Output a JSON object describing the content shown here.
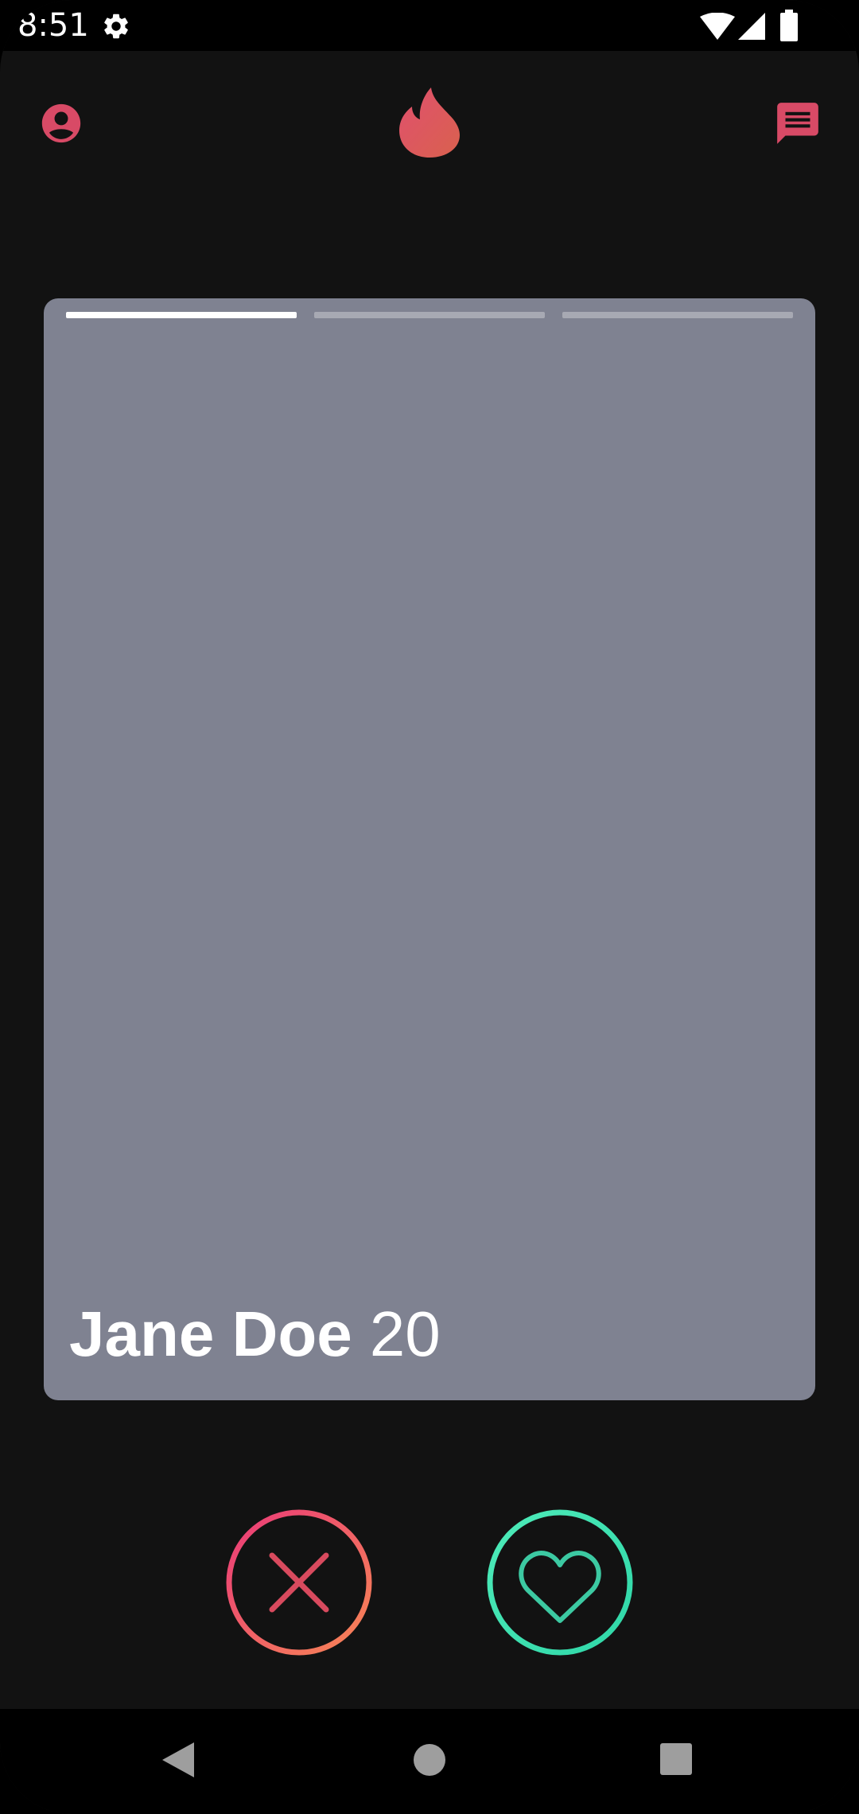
{
  "status_bar": {
    "time": "8:51",
    "icons": [
      "settings-gear-icon",
      "wifi-icon",
      "cellular-signal-icon",
      "battery-icon"
    ]
  },
  "header": {
    "left_icon": "profile-icon",
    "center_icon": "flame-logo-icon",
    "right_icon": "messages-icon"
  },
  "card": {
    "photo_count": 3,
    "active_photo": 1,
    "name": "Jane Doe",
    "age": "20"
  },
  "actions": {
    "dislike_icon": "close-x-icon",
    "like_icon": "heart-icon"
  },
  "nav": {
    "icons": [
      "back-icon",
      "home-icon",
      "recents-icon"
    ]
  },
  "colors": {
    "background": "#121212",
    "card": "#7f8291",
    "accent_pink": "#e0506e",
    "accent_orange": "#f07a5a",
    "like_green": "#3ddfb3"
  }
}
